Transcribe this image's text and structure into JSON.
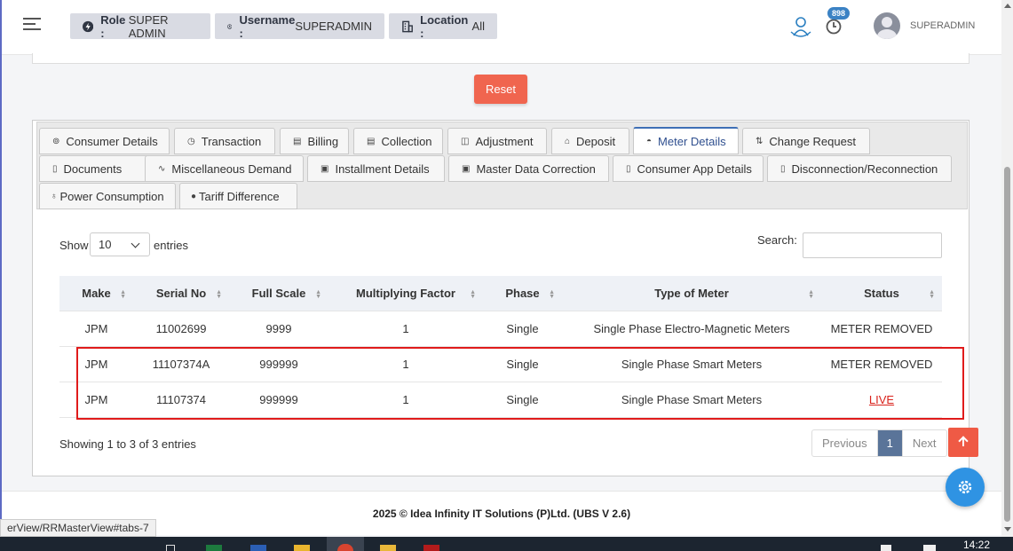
{
  "header": {
    "role_label": "Role :",
    "role_value": "SUPER ADMIN",
    "username_label": "Username :",
    "username_value": "SUPERADMIN",
    "location_label": "Location :",
    "location_value": "All",
    "notification_count": "898",
    "user_name": "SUPERADMIN"
  },
  "reset_label": "Reset",
  "tabs": [
    {
      "label": "Consumer Details",
      "icon": "⊚"
    },
    {
      "label": "Transaction",
      "icon": "◷"
    },
    {
      "label": "Billing",
      "icon": "▤"
    },
    {
      "label": "Collection",
      "icon": "▤"
    },
    {
      "label": "Adjustment",
      "icon": "◫"
    },
    {
      "label": "Deposit",
      "icon": "⌂"
    },
    {
      "label": "Meter Details",
      "icon": "◓"
    },
    {
      "label": "Change Request",
      "icon": "⇅"
    },
    {
      "label": "Documents",
      "icon": "▯"
    },
    {
      "label": "Miscellaneous Demand",
      "icon": "∿"
    },
    {
      "label": "Installment Details",
      "icon": "▣"
    },
    {
      "label": "Master Data Correction",
      "icon": "▣"
    },
    {
      "label": "Consumer App Details",
      "icon": "▯"
    },
    {
      "label": "Disconnection/Reconnection",
      "icon": "▯"
    },
    {
      "label": "Power Consumption",
      "icon": "♁"
    },
    {
      "label": "Tariff Difference",
      "icon": "●"
    }
  ],
  "controls": {
    "show_label": "Show",
    "entries_value": "10",
    "entries_label": "entries",
    "search_label": "Search:"
  },
  "table": {
    "headers": [
      "Make",
      "Serial No",
      "Full Scale",
      "Multiplying Factor",
      "Phase",
      "Type of Meter",
      "Status"
    ],
    "rows": [
      [
        "JPM",
        "11002699",
        "9999",
        "1",
        "Single",
        "Single Phase Electro-Magnetic Meters",
        "METER REMOVED"
      ],
      [
        "JPM",
        "11107374A",
        "999999",
        "1",
        "Single",
        "Single Phase Smart Meters",
        "METER REMOVED"
      ],
      [
        "JPM",
        "11107374",
        "999999",
        "1",
        "Single",
        "Single Phase Smart Meters",
        "LIVE"
      ]
    ]
  },
  "info_text": "Showing 1 to 3 of 3 entries",
  "pager": {
    "previous": "Previous",
    "current": "1",
    "next": "Next"
  },
  "footer_text": "2025 © Idea Infinity IT Solutions (P)Ltd. (UBS V 2.6)",
  "status_url": "erView/RRMasterView#tabs-7",
  "taskbar_time": "14:22",
  "colors": {
    "accent": "#3f6fb5",
    "reset": "#f0654f",
    "highlight": "#e01b1b",
    "live": "#d9231c"
  }
}
